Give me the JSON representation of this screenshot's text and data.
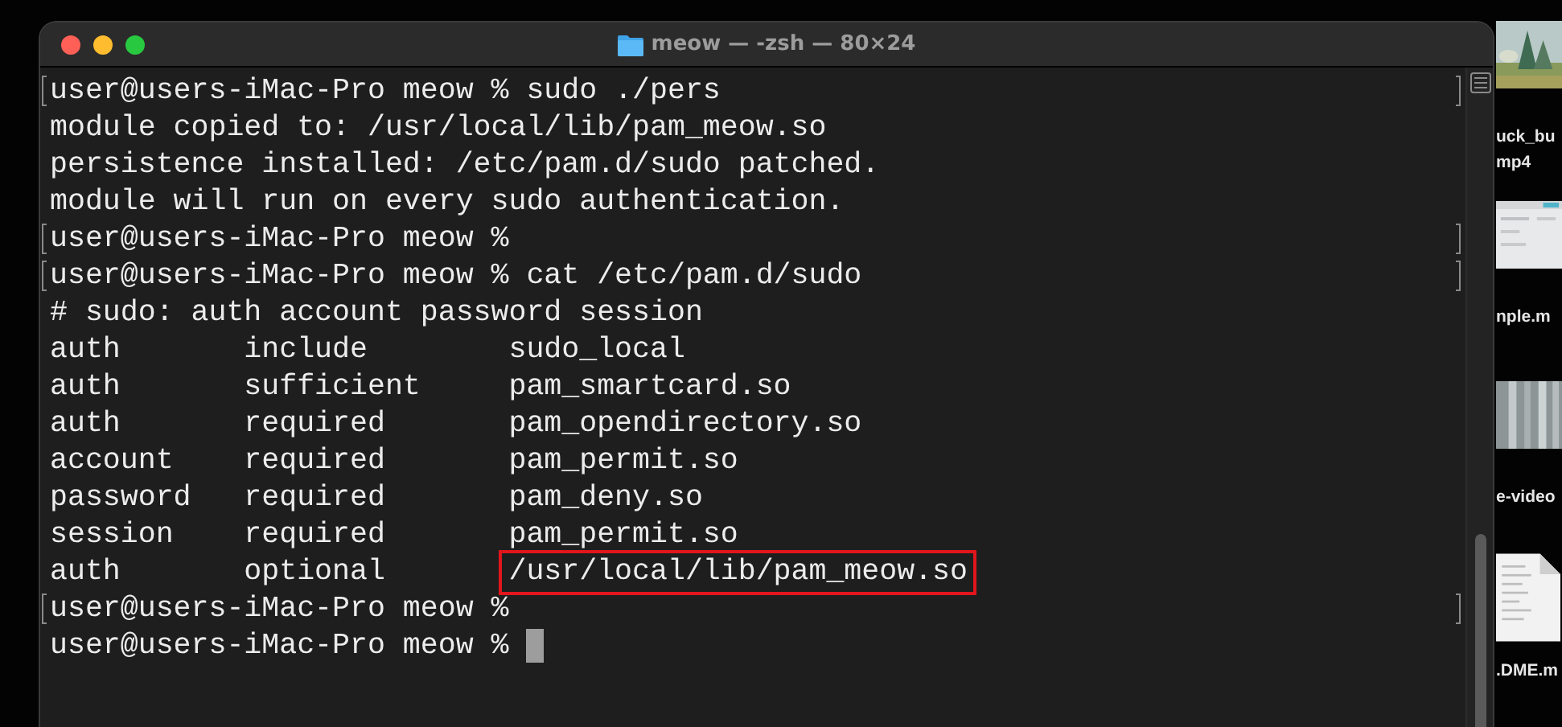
{
  "window": {
    "title": "meow — -zsh — 80×24"
  },
  "terminal": {
    "lines": [
      {
        "text": "user@users-iMac-Pro meow % sudo ./pers",
        "marked": true,
        "cursor": false
      },
      {
        "text": "module copied to: /usr/local/lib/pam_meow.so",
        "marked": false,
        "cursor": false
      },
      {
        "text": "persistence installed: /etc/pam.d/sudo patched.",
        "marked": false,
        "cursor": false
      },
      {
        "text": "module will run on every sudo authentication.",
        "marked": false,
        "cursor": false
      },
      {
        "text": "user@users-iMac-Pro meow %",
        "marked": true,
        "cursor": false
      },
      {
        "text": "user@users-iMac-Pro meow % cat /etc/pam.d/sudo",
        "marked": true,
        "cursor": false
      },
      {
        "text": "# sudo: auth account password session",
        "marked": false,
        "cursor": false
      },
      {
        "text": "auth       include        sudo_local",
        "marked": false,
        "cursor": false
      },
      {
        "text": "auth       sufficient     pam_smartcard.so",
        "marked": false,
        "cursor": false
      },
      {
        "text": "auth       required       pam_opendirectory.so",
        "marked": false,
        "cursor": false
      },
      {
        "text": "account    required       pam_permit.so",
        "marked": false,
        "cursor": false
      },
      {
        "text": "password   required       pam_deny.so",
        "marked": false,
        "cursor": false
      },
      {
        "text": "session    required       pam_permit.so",
        "marked": false,
        "cursor": false
      },
      {
        "text": "auth       optional       ",
        "highlight": "/usr/local/lib/pam_meow.so",
        "marked": false,
        "cursor": false
      },
      {
        "text": "user@users-iMac-Pro meow %",
        "marked": true,
        "cursor": false
      },
      {
        "text": "user@users-iMac-Pro meow % ",
        "marked": false,
        "cursor": true
      }
    ]
  },
  "desktop": {
    "files": [
      {
        "label": "uck_bu\nmp4"
      },
      {
        "kind": "screenshot",
        "label": "nple.m"
      },
      {
        "kind": "photo2",
        "label": "e-video"
      },
      {
        "kind": "document",
        "label": ".DME.m"
      }
    ]
  }
}
